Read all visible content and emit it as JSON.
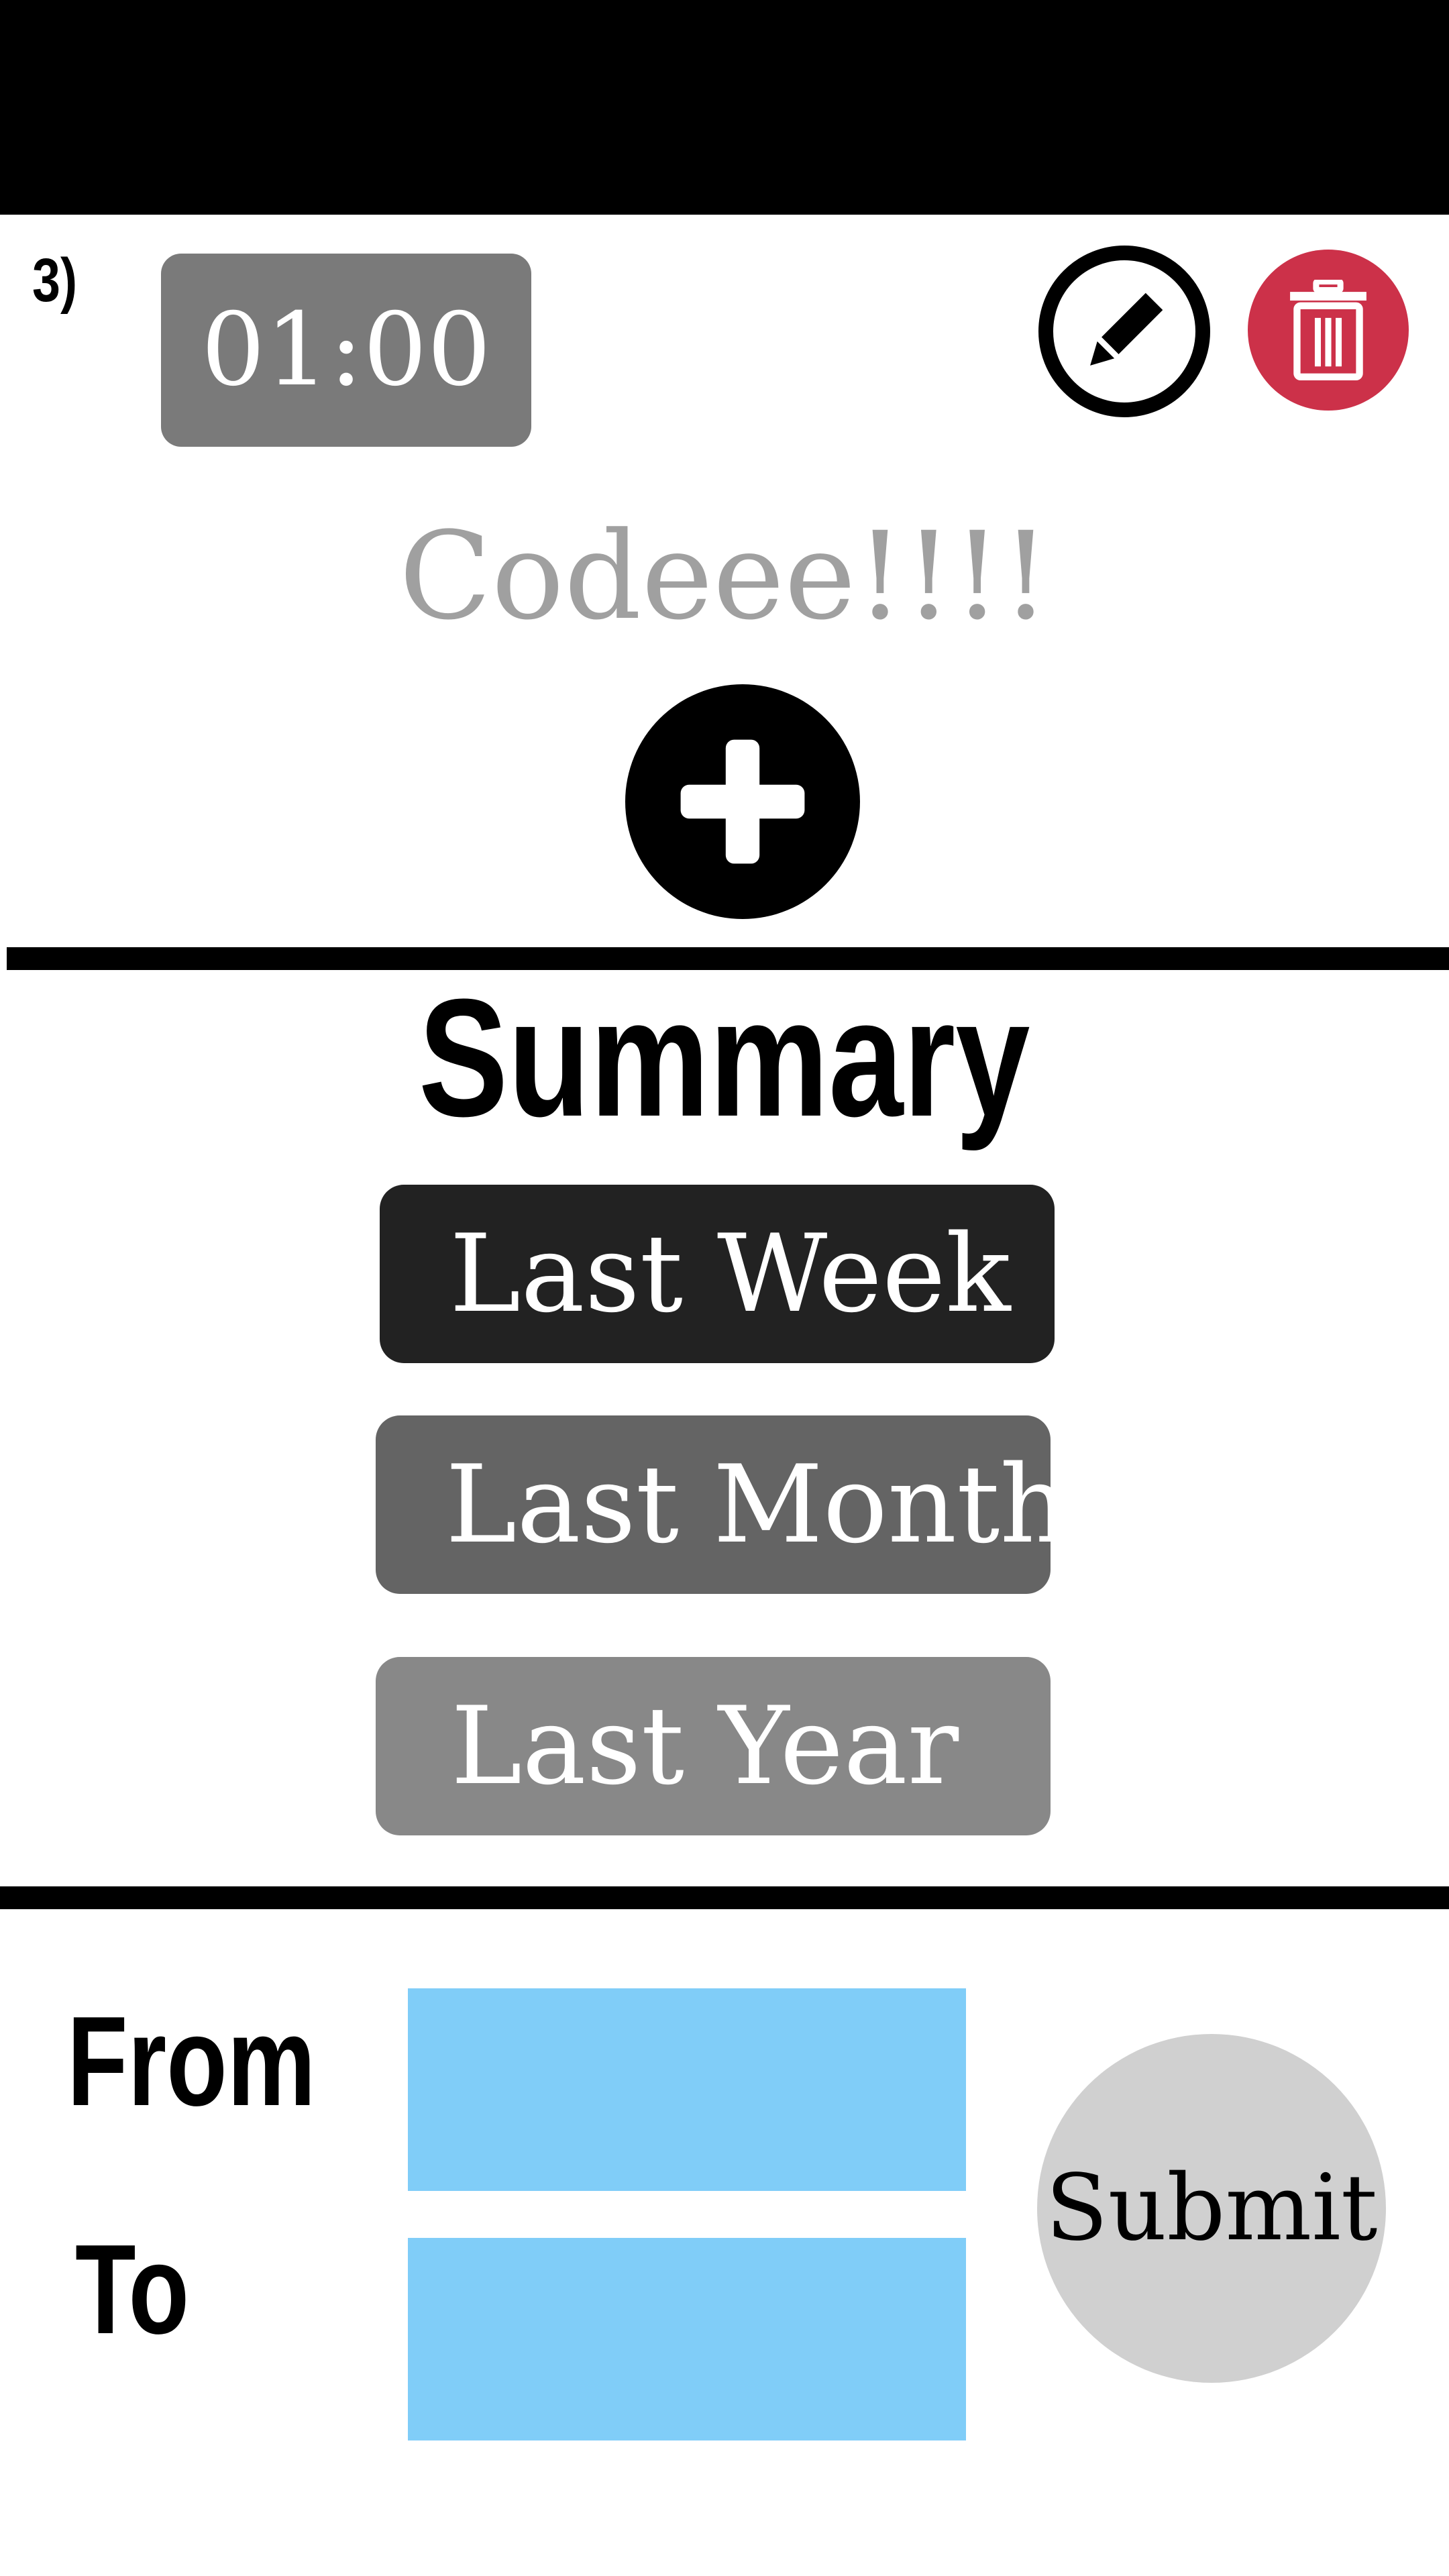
{
  "header": {
    "item_number": "3)",
    "timer": "01:00",
    "edit_icon": "pencil-icon",
    "delete_icon": "trash-icon"
  },
  "task": {
    "title": "Codeee!!!!",
    "add_icon": "plus-icon"
  },
  "summary": {
    "title": "Summary",
    "buttons": [
      {
        "label": "Last Week",
        "color": "#222222"
      },
      {
        "label": "Last Month",
        "color": "#646464"
      },
      {
        "label": "Last Year",
        "color": "#888888"
      }
    ]
  },
  "range_form": {
    "from_label": "From",
    "to_label": "To",
    "from_value": "",
    "to_value": "",
    "submit_label": "Submit",
    "input_color": "#80cdf8"
  },
  "colors": {
    "delete": "#cc3149",
    "top_bar": "#000000",
    "title": "#a0a0a0"
  }
}
